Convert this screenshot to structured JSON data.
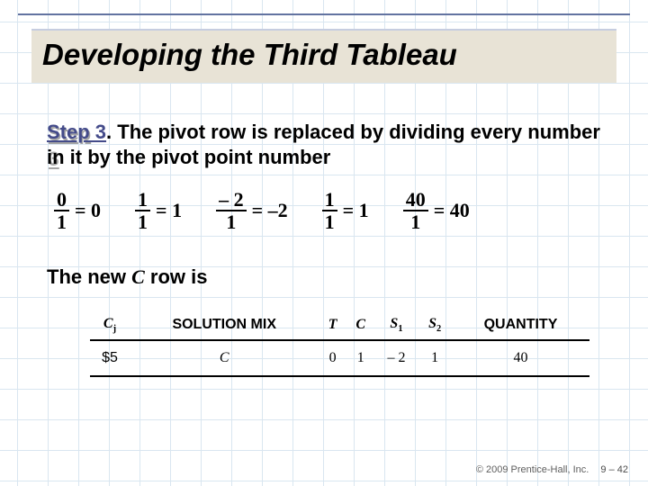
{
  "title": "Developing the Third Tableau",
  "step": {
    "label": "Step 3",
    "text_part1": ". The pivot row is replaced by dividing every number in it by the pivot point number"
  },
  "equations": [
    {
      "num": "0",
      "den": "1",
      "result": "= 0"
    },
    {
      "num": "1",
      "den": "1",
      "result": "= 1"
    },
    {
      "num": "– 2",
      "den": "1",
      "result": "= –2"
    },
    {
      "num": "1",
      "den": "1",
      "result": "= 1"
    },
    {
      "num": "40",
      "den": "1",
      "result": "= 40"
    }
  ],
  "new_row_text": {
    "pre": "The new ",
    "var": "C",
    "post": " row is"
  },
  "tableau": {
    "headers": {
      "cj": "C",
      "cj_sub": "j",
      "solmix": "SOLUTION MIX",
      "t": "T",
      "c": "C",
      "s1": "S",
      "s1_sub": "1",
      "s2": "S",
      "s2_sub": "2",
      "qty": "QUANTITY"
    },
    "row": {
      "cj": "$5",
      "solmix": "C",
      "t": "0",
      "c": "1",
      "s1": "– 2",
      "s2": "1",
      "qty": "40"
    }
  },
  "footer": {
    "copyright": "© 2009 Prentice-Hall, Inc.",
    "page": "9 – 42"
  }
}
